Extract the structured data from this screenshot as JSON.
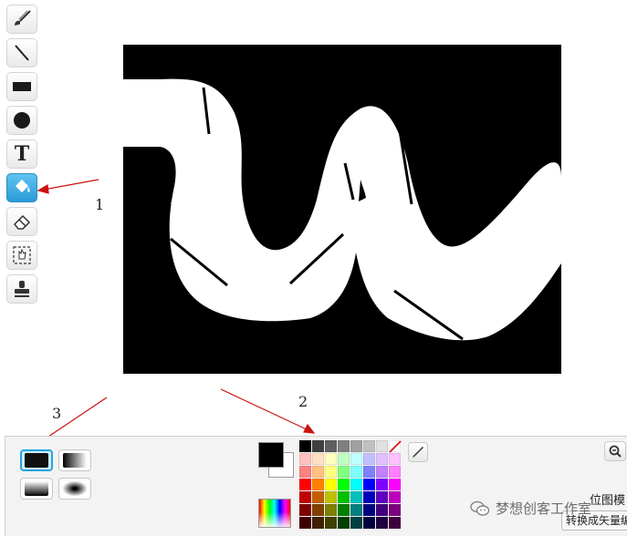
{
  "tools": [
    {
      "name": "brush-tool",
      "icon": "paintbrush-icon"
    },
    {
      "name": "line-tool",
      "icon": "line-icon"
    },
    {
      "name": "rectangle-tool",
      "icon": "rectangle-icon"
    },
    {
      "name": "ellipse-tool",
      "icon": "ellipse-icon"
    },
    {
      "name": "text-tool",
      "icon": "text-icon",
      "glyph": "T"
    },
    {
      "name": "fill-tool",
      "icon": "paint-bucket-icon",
      "selected": true
    },
    {
      "name": "eraser-tool",
      "icon": "eraser-icon"
    },
    {
      "name": "select-tool",
      "icon": "select-icon"
    },
    {
      "name": "stamp-tool",
      "icon": "stamp-icon"
    }
  ],
  "annotations": {
    "label1": "1",
    "label2": "2",
    "label3": "3",
    "arrow_color": "#cc1111"
  },
  "fill_styles": [
    {
      "name": "solid",
      "selected": true
    },
    {
      "name": "horizontal-gradient"
    },
    {
      "name": "vertical-gradient"
    },
    {
      "name": "radial-gradient"
    }
  ],
  "colors": {
    "foreground": "#000000",
    "background": "#ffffff",
    "accent": "#29a3e0"
  },
  "palette": [
    [
      "#000000",
      "#3f3f3f",
      "#5f5f5f",
      "#7f7f7f",
      "#a0a0a0",
      "#c0c0c0",
      "#e0e0e0",
      "#ffffff"
    ],
    [
      "#ffc0c0",
      "#ffe0c0",
      "#ffffc0",
      "#c0ffc0",
      "#c0ffff",
      "#c0c0ff",
      "#e0c0ff",
      "#ffc0ff"
    ],
    [
      "#ff8080",
      "#ffc080",
      "#ffff80",
      "#80ff80",
      "#80ffff",
      "#8080ff",
      "#c080ff",
      "#ff80ff"
    ],
    [
      "#ff0000",
      "#ff8000",
      "#ffff00",
      "#00ff00",
      "#00ffff",
      "#0000ff",
      "#8000ff",
      "#ff00ff"
    ],
    [
      "#c00000",
      "#c06000",
      "#c0c000",
      "#00c000",
      "#00c0c0",
      "#0000c0",
      "#6000c0",
      "#c000c0"
    ],
    [
      "#800000",
      "#804000",
      "#808000",
      "#008000",
      "#008080",
      "#000080",
      "#400080",
      "#800080"
    ],
    [
      "#400000",
      "#402000",
      "#404000",
      "#004000",
      "#004040",
      "#000040",
      "#200040",
      "#400040"
    ]
  ],
  "bottom": {
    "mode_label": "位图模",
    "convert_button": "转换成矢量编",
    "watermark": "梦想创客工作室"
  }
}
